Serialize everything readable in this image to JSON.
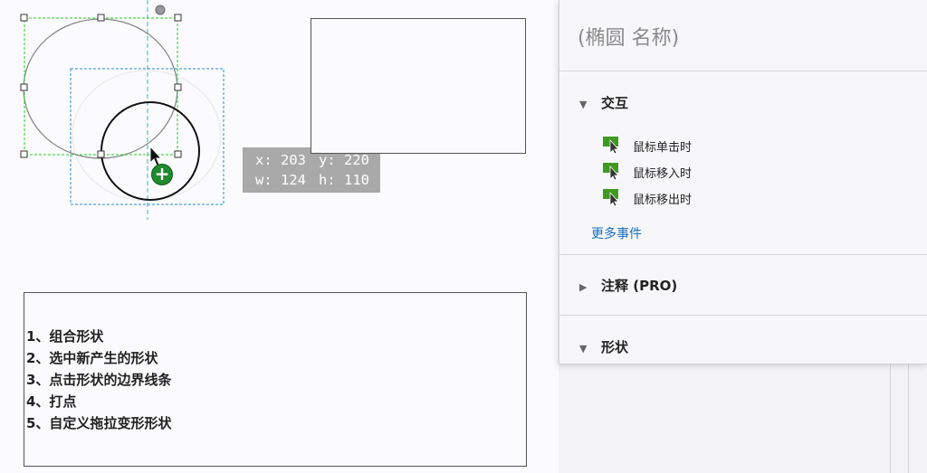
{
  "canvas": {
    "coords": {
      "x": "x: 203",
      "y": "y: 220",
      "w": "w: 124",
      "h": "h: 110"
    },
    "add_badge_glyph": "+",
    "notes": [
      "1、组合形状",
      "2、选中新产生的形状",
      "3、点击形状的边界线条",
      "4、打点",
      "5、自定义拖拉变形形状"
    ]
  },
  "inspector": {
    "title": "(椭圆 名称)",
    "interaction": {
      "label": "交互",
      "events": [
        {
          "label": "鼠标单击时",
          "icon": "event-cursor-icon"
        },
        {
          "label": "鼠标移入时",
          "icon": "event-cursor-icon"
        },
        {
          "label": "鼠标移出时",
          "icon": "event-cursor-icon"
        }
      ],
      "more_link": "更多事件"
    },
    "notes_section": {
      "label": "注释 (PRO)"
    },
    "shape_section": {
      "label": "形状"
    }
  },
  "colors": {
    "selection_green": "#22cc22",
    "selection_blue": "#2a8ad8",
    "guide_cyan": "#29b6e8",
    "event_icon_green": "#3f9a1f",
    "link_blue": "#1a6fbd"
  }
}
